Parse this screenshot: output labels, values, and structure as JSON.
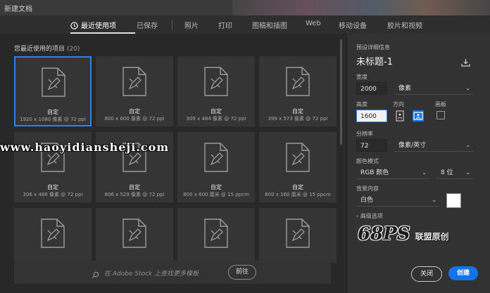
{
  "window": {
    "title": "新建文档"
  },
  "tabs": [
    {
      "label": "最近使用项"
    },
    {
      "label": "已保存"
    },
    {
      "label": "照片"
    },
    {
      "label": "打印"
    },
    {
      "label": "图稿和插图"
    },
    {
      "label": "Web"
    },
    {
      "label": "移动设备"
    },
    {
      "label": "胶片和视频"
    }
  ],
  "recent": {
    "title": "您最近使用的项目",
    "count": "(20)",
    "items": [
      {
        "name": "自定",
        "size": "1920 x 1080 像素 @ 72 ppi"
      },
      {
        "name": "自定",
        "size": "800 x 600 像素 @ 72 ppi"
      },
      {
        "name": "自定",
        "size": "309 x 484 像素 @ 72 ppi"
      },
      {
        "name": "自定",
        "size": "399 x 573 像素 @ 72 ppi"
      },
      {
        "name": "自定",
        "size": "306 x 486 像素 @ 72 ppi"
      },
      {
        "name": "自定",
        "size": "806 x 529 像素 @ 72 ppi"
      },
      {
        "name": "自定",
        "size": "800 x 600 厘米 @ 15 ppcm"
      },
      {
        "name": "自定",
        "size": "800 x 160 厘米 @ 15 ppcm"
      },
      {
        "name": "",
        "size": ""
      },
      {
        "name": "",
        "size": ""
      },
      {
        "name": "",
        "size": ""
      },
      {
        "name": "",
        "size": ""
      }
    ]
  },
  "search": {
    "placeholder": "在 Adobe Stock 上查找更多模板",
    "go_label": "前往"
  },
  "details": {
    "header": "预设详细信息",
    "doc_title": "未标题-1",
    "width_label": "宽度",
    "width_value": "2000",
    "width_unit": "像素",
    "height_label": "高度",
    "height_value": "1600",
    "orientation_label": "方向",
    "artboard_label": "画板",
    "resolution_label": "分辨率",
    "resolution_value": "72",
    "resolution_unit": "像素/英寸",
    "color_mode_label": "颜色模式",
    "color_mode_value": "RGB 颜色",
    "bit_depth_value": "8 位",
    "background_label": "背景内容",
    "background_value": "白色",
    "background_color": "#ffffff",
    "advanced_label": "高级选项"
  },
  "buttons": {
    "close_label": "关闭",
    "create_label": "创建"
  },
  "overlay": {
    "watermark": "www.haoyidiansheji.com",
    "logo_big": "68PS",
    "logo_small": "联盟原创"
  },
  "colors": {
    "accent": "#1473e6",
    "selected_border": "#2f80ed"
  }
}
